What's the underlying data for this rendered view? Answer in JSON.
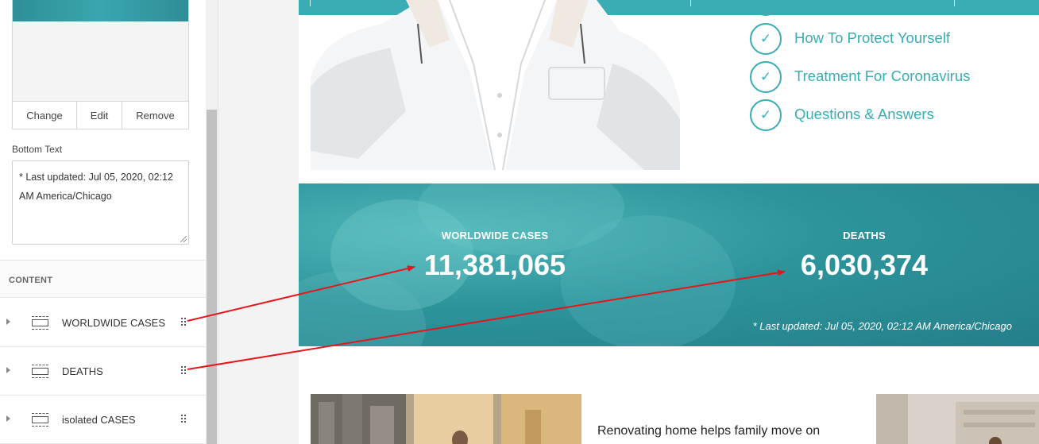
{
  "editor": {
    "image_actions": {
      "change": "Change",
      "edit": "Edit",
      "remove": "Remove"
    },
    "bottom_text": {
      "label": "Bottom Text",
      "value": "* Last updated: Jul 05, 2020, 02:12 AM America/Chicago"
    },
    "content_section": {
      "title": "CONTENT",
      "items": [
        {
          "label": "WORLDWIDE CASES"
        },
        {
          "label": "DEATHS"
        },
        {
          "label": "isolated CASES"
        }
      ]
    }
  },
  "preview": {
    "checklist": [
      {
        "label": "How To Protect Yourself"
      },
      {
        "label": "Treatment For Coronavirus"
      },
      {
        "label": "Questions & Answers"
      }
    ],
    "stats": [
      {
        "label": "WORLDWIDE CASES",
        "value": "11,381,065"
      },
      {
        "label": "DEATHS",
        "value": "6,030,374"
      }
    ],
    "stats_footer": "* Last updated: Jul 05, 2020, 02:12 AM America/Chicago",
    "article_title": "Renovating home helps family move on after"
  },
  "colors": {
    "accent": "#3aacb4",
    "annotation_arrow": "#e8141c"
  },
  "icons": [
    "check-icon",
    "block-icon",
    "drag-handle-icon",
    "expand-caret-icon",
    "resize-handle-icon"
  ]
}
